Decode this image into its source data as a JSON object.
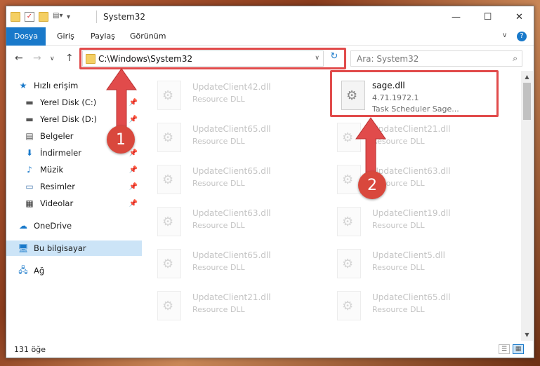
{
  "window": {
    "title": "System32"
  },
  "ribbon": {
    "tabs": [
      "Dosya",
      "Giriş",
      "Paylaş",
      "Görünüm"
    ]
  },
  "address": {
    "path": "C:\\Windows\\System32"
  },
  "search": {
    "placeholder": "Ara: System32"
  },
  "sidebar": {
    "items": [
      {
        "label": "Hızlı erişim",
        "icon": "star-icon"
      },
      {
        "label": "Yerel Disk (C:)",
        "icon": "drive-icon"
      },
      {
        "label": "Yerel Disk (D:)",
        "icon": "drive-icon"
      },
      {
        "label": "Belgeler",
        "icon": "document-icon"
      },
      {
        "label": "İndirmeler",
        "icon": "download-icon"
      },
      {
        "label": "Müzik",
        "icon": "music-icon"
      },
      {
        "label": "Resimler",
        "icon": "pictures-icon"
      },
      {
        "label": "Videolar",
        "icon": "video-icon"
      },
      {
        "label": "OneDrive",
        "icon": "cloud-icon"
      },
      {
        "label": "Bu bilgisayar",
        "icon": "computer-icon"
      },
      {
        "label": "Ağ",
        "icon": "network-icon"
      }
    ]
  },
  "files": {
    "left": [
      {
        "name": "UpdateClient42.dll",
        "type": "Resource DLL"
      },
      {
        "name": "UpdateClient65.dll",
        "type": "Resource DLL"
      },
      {
        "name": "UpdateClient65.dll",
        "type": "Resource DLL"
      },
      {
        "name": "UpdateClient63.dll",
        "type": "Resource DLL"
      },
      {
        "name": "UpdateClient65.dll",
        "type": "Resource DLL"
      },
      {
        "name": "UpdateClient21.dll",
        "type": "Resource DLL"
      }
    ],
    "right": [
      {
        "name": "UpdateClient21.dll",
        "type": "Resource DLL"
      },
      {
        "name": "UpdateClient63.dll",
        "type": "Resource DLL"
      },
      {
        "name": "UpdateClient19.dll",
        "type": "Resource DLL"
      },
      {
        "name": "UpdateClient5.dll",
        "type": "Resource DLL"
      },
      {
        "name": "UpdateClient65.dll",
        "type": "Resource DLL"
      }
    ],
    "selected": {
      "name": "sage.dll",
      "version": "4.71.1972.1",
      "description": "Task Scheduler Sage..."
    }
  },
  "status": {
    "count": "131 öğe"
  },
  "annotations": {
    "badge1": "1",
    "badge2": "2"
  },
  "colors": {
    "accent": "#1979ca",
    "highlight": "#e14b4b"
  }
}
